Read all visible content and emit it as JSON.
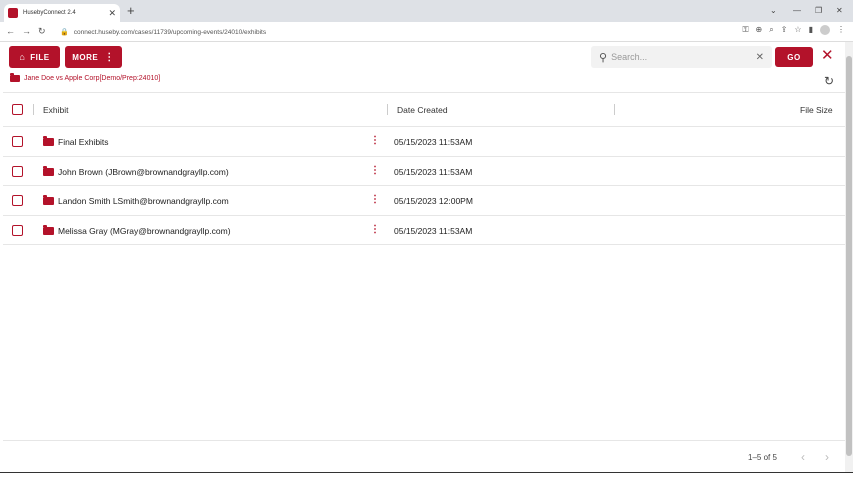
{
  "browser": {
    "tab_title": "HusebyConnect 2.4",
    "url": "connect.huseby.com/cases/11739/upcoming-events/24010/exhibits",
    "new_tab_glyph": "+",
    "tab_close_glyph": "✕"
  },
  "toolbar": {
    "file_label": "FILE",
    "more_label": "MORE",
    "search_placeholder": "Search...",
    "go_label": "GO"
  },
  "breadcrumb": {
    "label": "Jane Doe vs Apple Corp[Demo/Prep:24010]"
  },
  "table": {
    "columns": [
      "Exhibit",
      "Date Created",
      "File Size"
    ],
    "rows": [
      {
        "name": "Final Exhibits",
        "date": "05/15/2023 11:53AM",
        "size": ""
      },
      {
        "name": "John Brown (JBrown@brownandgrayllp.com)",
        "date": "05/15/2023 11:53AM",
        "size": ""
      },
      {
        "name": "Landon Smith LSmith@brownandgrayllp.com",
        "date": "05/15/2023 12:00PM",
        "size": ""
      },
      {
        "name": "Melissa Gray (MGray@brownandgrayllp.com)",
        "date": "05/15/2023 11:53AM",
        "size": ""
      }
    ]
  },
  "pagination": {
    "info": "1–5 of 5"
  },
  "colors": {
    "accent": "#b3122a"
  }
}
